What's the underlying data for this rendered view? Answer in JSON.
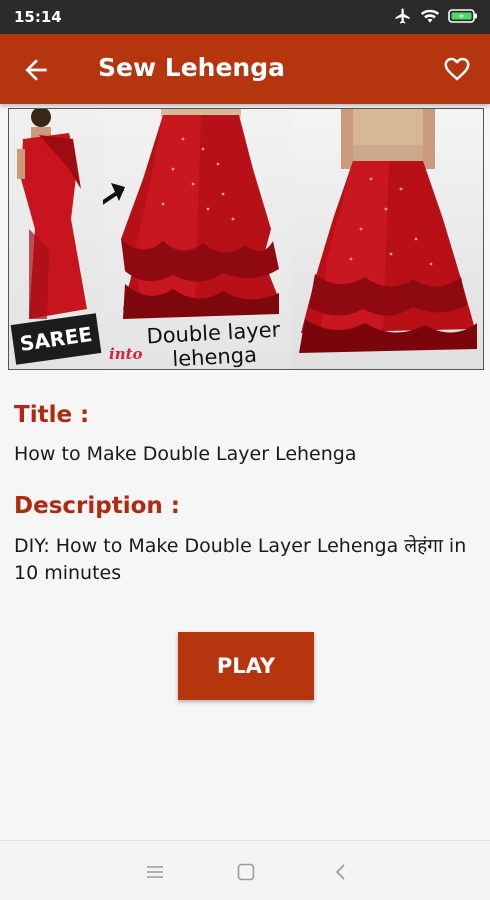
{
  "status_bar": {
    "time": "15:14",
    "icons": [
      "airplane-icon",
      "wifi-icon",
      "battery-charging-icon"
    ]
  },
  "app_bar": {
    "title": "Sew Lehenga",
    "back_icon": "arrow-left-icon",
    "favorite_icon": "heart-outline-icon",
    "color": "#b5350f"
  },
  "banner": {
    "saree_label": "SAREE",
    "into_label": "into",
    "double_layer_label": "Double layer lehenga"
  },
  "details": {
    "title_label": "Title :",
    "title_value": "How to Make Double Layer Lehenga",
    "description_label": "Description :",
    "description_value": "DIY: How to Make Double Layer Lehenga लेहंगा in 10 minutes"
  },
  "play_button": {
    "label": "PLAY"
  },
  "nav_bar": {
    "items": [
      "menu-icon",
      "home-square-icon",
      "back-chevron-icon"
    ]
  }
}
